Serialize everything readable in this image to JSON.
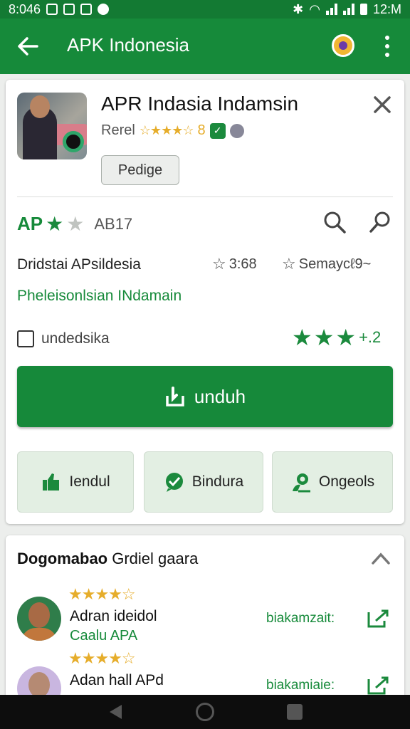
{
  "status_bar": {
    "time_left": "8:046",
    "time_right": "12:M"
  },
  "app_bar": {
    "title": "APK Indonesia"
  },
  "app": {
    "name": "APR Indasia Indamsin",
    "meta_label": "Rerel",
    "stars_text": "☆★★★☆",
    "rating_num": "8",
    "badge_glyph": "✓",
    "tag_button": "Pedige"
  },
  "summary": {
    "ap_label": "AP",
    "code": "AB17",
    "info_line": "Dridstai APsildesia",
    "stat1": "3:68",
    "stat2": "Semaycℓ9~",
    "green_line": "Pheleisonlsian INdamain",
    "checkbox_label": "undedsika",
    "rating_value": "+.2"
  },
  "download_button": {
    "label": "unduh"
  },
  "actions": [
    {
      "label": "Iendul"
    },
    {
      "label": "Bindura"
    },
    {
      "label": "Ongeols"
    }
  ],
  "reviews_section": {
    "title_bold": "Dogomabao",
    "title_rest": " Grdiel gaara",
    "reviews": [
      {
        "stars": "★★★★☆",
        "name": "Adran ideidol",
        "sub": "Caalu APA",
        "link": "biakamzait:"
      },
      {
        "stars": "★★★★☆",
        "name": "Adan hall APd",
        "sub": "",
        "link": "biakamiaie:"
      }
    ]
  },
  "colors": {
    "primary": "#168a3a",
    "star": "#e6ad2b",
    "background": "#eceeec"
  }
}
